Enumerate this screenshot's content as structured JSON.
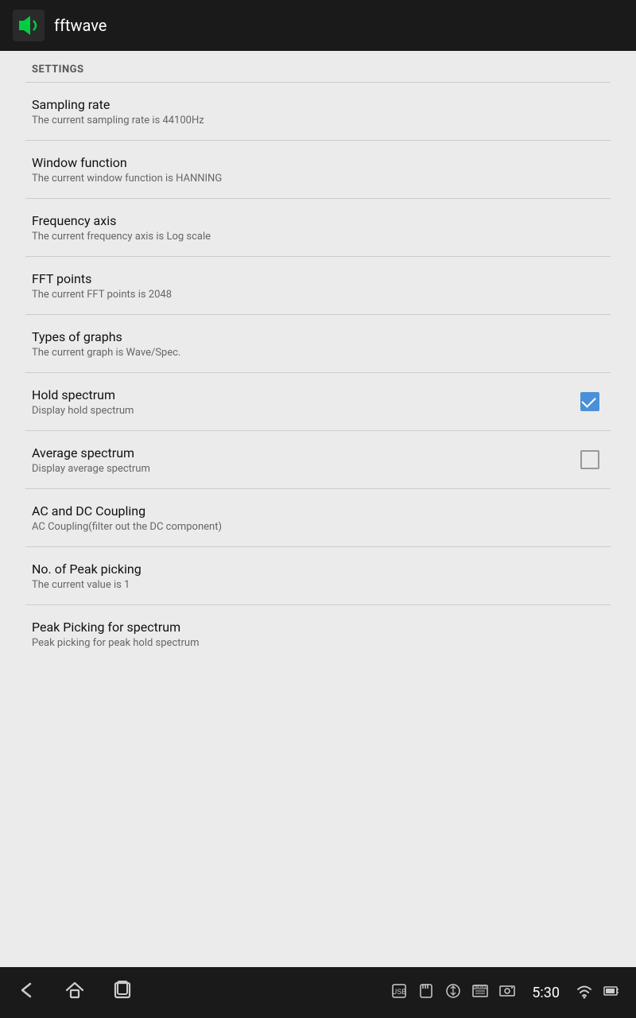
{
  "appBar": {
    "title": "fftwave",
    "iconAlt": "fftwave app icon"
  },
  "settings": {
    "header": "SETTINGS",
    "items": [
      {
        "id": "sampling-rate",
        "title": "Sampling rate",
        "subtitle": "The current sampling rate is 44100Hz",
        "hasCheckbox": false,
        "checked": null
      },
      {
        "id": "window-function",
        "title": "Window function",
        "subtitle": "The current window function is HANNING",
        "hasCheckbox": false,
        "checked": null
      },
      {
        "id": "frequency-axis",
        "title": "Frequency axis",
        "subtitle": "The current frequency axis is Log scale",
        "hasCheckbox": false,
        "checked": null
      },
      {
        "id": "fft-points",
        "title": "FFT points",
        "subtitle": "The current FFT points is 2048",
        "hasCheckbox": false,
        "checked": null
      },
      {
        "id": "types-of-graphs",
        "title": "Types of graphs",
        "subtitle": "The current graph is Wave/Spec.",
        "hasCheckbox": false,
        "checked": null
      },
      {
        "id": "hold-spectrum",
        "title": "Hold spectrum",
        "subtitle": "Display hold spectrum",
        "hasCheckbox": true,
        "checked": true
      },
      {
        "id": "average-spectrum",
        "title": "Average spectrum",
        "subtitle": "Display average spectrum",
        "hasCheckbox": true,
        "checked": false
      },
      {
        "id": "ac-dc-coupling",
        "title": "AC and DC Coupling",
        "subtitle": "AC Coupling(filter out the DC component)",
        "hasCheckbox": false,
        "checked": null
      },
      {
        "id": "peak-picking-no",
        "title": "No. of Peak picking",
        "subtitle": "The current value is 1",
        "hasCheckbox": false,
        "checked": null
      },
      {
        "id": "peak-picking-spectrum",
        "title": "Peak Picking for spectrum",
        "subtitle": "Peak picking for peak hold spectrum",
        "hasCheckbox": false,
        "checked": null
      }
    ]
  },
  "navBar": {
    "time": "5:30",
    "backLabel": "back",
    "homeLabel": "home",
    "recentLabel": "recent",
    "usbLabel": "usb",
    "sdcardLabel": "sdcard",
    "newsLabel": "news",
    "photoLabel": "photo",
    "wifiLabel": "wifi",
    "batteryLabel": "battery"
  }
}
